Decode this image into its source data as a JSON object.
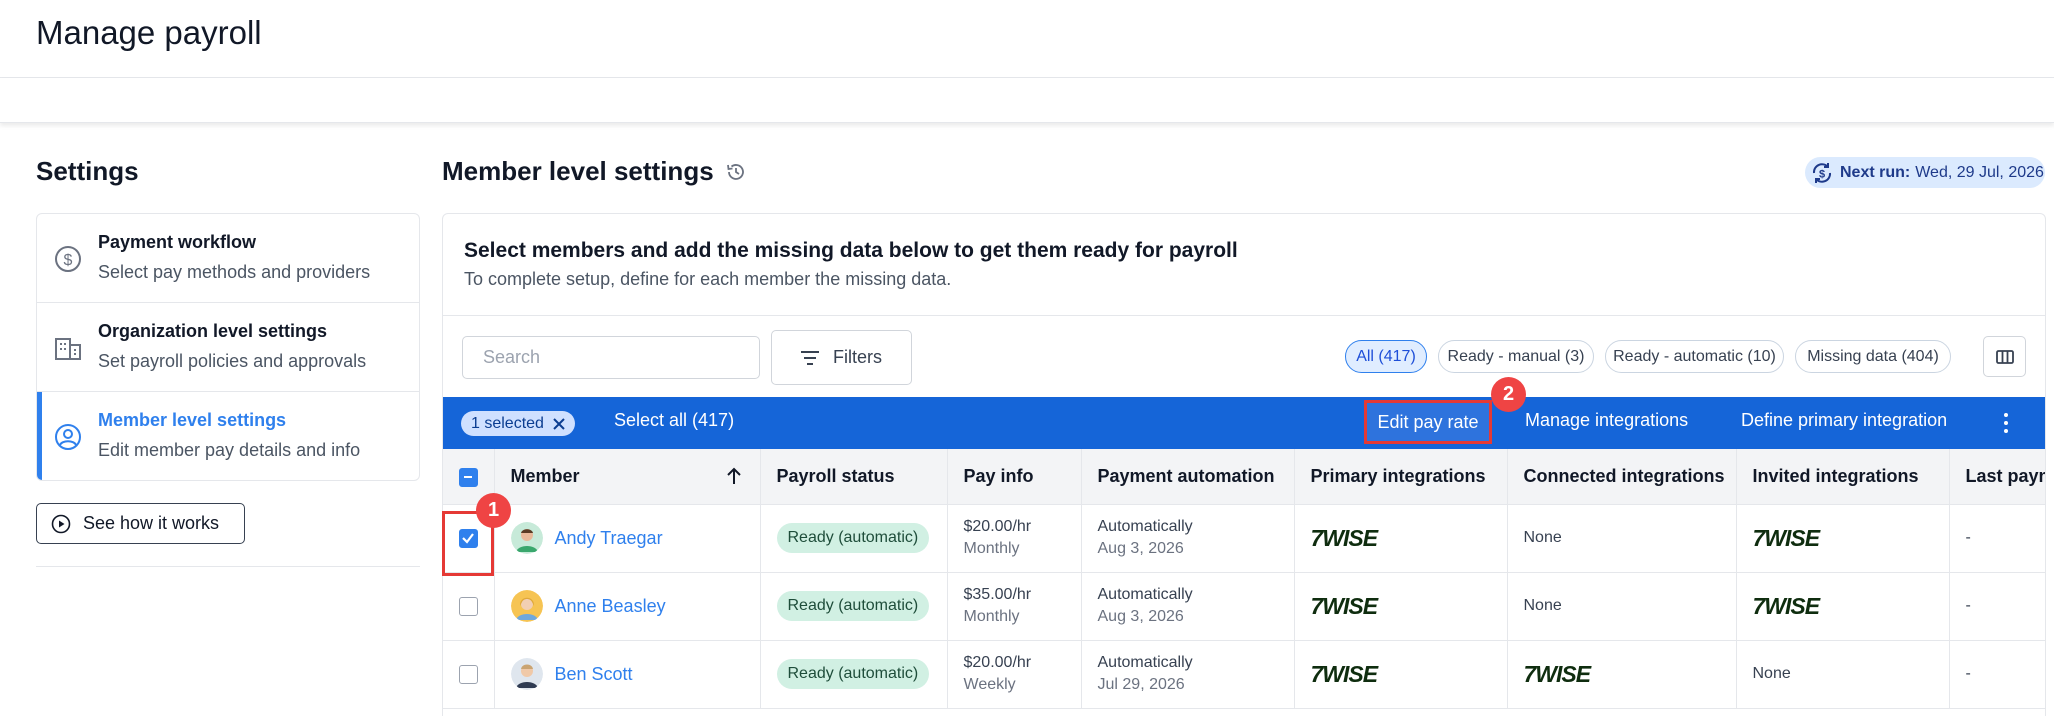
{
  "page": {
    "title": "Manage payroll"
  },
  "settings": {
    "title": "Settings",
    "items": [
      {
        "title": "Payment workflow",
        "desc": "Select pay methods and providers",
        "icon": "dollar-circle-icon",
        "active": false
      },
      {
        "title": "Organization level settings",
        "desc": "Set payroll policies and approvals",
        "icon": "building-icon",
        "active": false
      },
      {
        "title": "Member level settings",
        "desc": "Edit member pay details and info",
        "icon": "user-circle-icon",
        "active": true
      }
    ],
    "see_how": "See how it works"
  },
  "main": {
    "title": "Member level settings",
    "next_run_label": "Next run:",
    "next_run_value": "Wed, 29 Jul, 2026",
    "panel_title": "Select members and add the missing data below to get them ready for payroll",
    "panel_desc": "To complete setup, define for each member the missing data."
  },
  "toolbar": {
    "search_placeholder": "Search",
    "filters_label": "Filters",
    "chips": [
      {
        "label": "All (417)",
        "active": true
      },
      {
        "label": "Ready - manual (3)",
        "active": false
      },
      {
        "label": "Ready - automatic (10)",
        "active": false
      },
      {
        "label": "Missing data (404)",
        "active": false
      }
    ]
  },
  "actionbar": {
    "selected_label": "1 selected",
    "select_all": "Select all (417)",
    "edit_pay_rate": "Edit pay rate",
    "manage_integrations": "Manage integrations",
    "define_primary": "Define primary integration"
  },
  "annotations": {
    "badge1": "1",
    "badge2": "2"
  },
  "table": {
    "headers": [
      "Member",
      "Payroll status",
      "Pay info",
      "Payment automation",
      "Primary integrations",
      "Connected integrations",
      "Invited integrations",
      "Last paym"
    ],
    "rows": [
      {
        "name": "Andy Traegar",
        "status": "Ready (automatic)",
        "pay": "$20.00/hr",
        "freq": "Monthly",
        "auto": "Automatically",
        "auto_date": "Aug 3, 2026",
        "primary": "7WISE",
        "connected": "None",
        "invited": "7WISE",
        "last": "-",
        "checked": true
      },
      {
        "name": "Anne Beasley",
        "status": "Ready (automatic)",
        "pay": "$35.00/hr",
        "freq": "Monthly",
        "auto": "Automatically",
        "auto_date": "Aug 3, 2026",
        "primary": "7WISE",
        "connected": "None",
        "invited": "7WISE",
        "last": "-",
        "checked": false
      },
      {
        "name": "Ben Scott",
        "status": "Ready (automatic)",
        "pay": "$20.00/hr",
        "freq": "Weekly",
        "auto": "Automatically",
        "auto_date": "Jul 29, 2026",
        "primary": "7WISE",
        "connected": "7WISE",
        "invited": "None",
        "last": "-",
        "checked": false
      }
    ]
  },
  "colors": {
    "accent": "#2f80ed",
    "action_bar": "#1565d8",
    "highlight": "#e53935",
    "status_bg": "#d1f0e3"
  }
}
